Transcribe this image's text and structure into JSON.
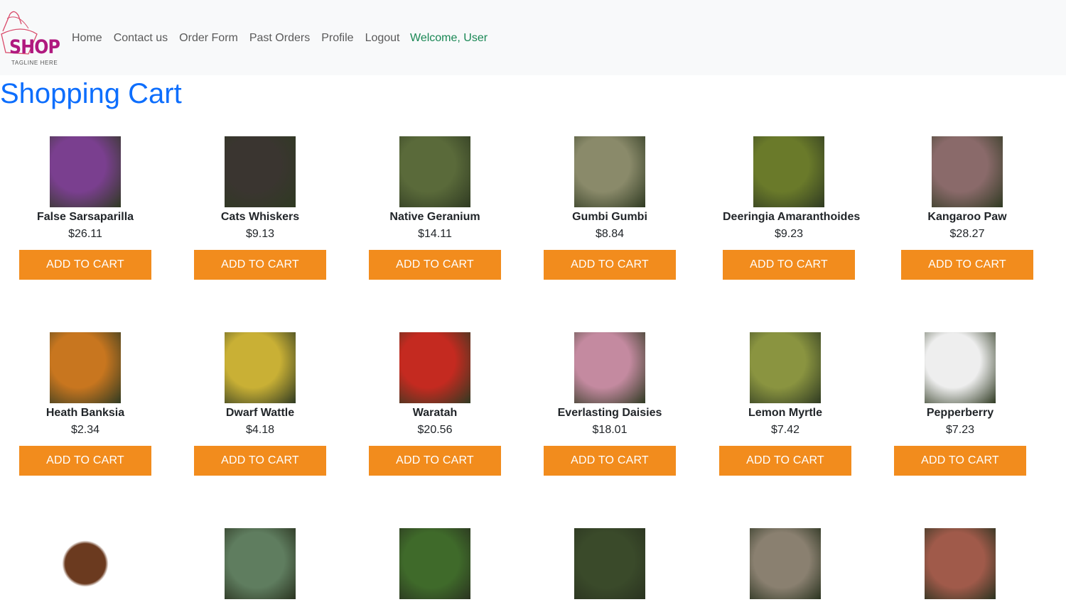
{
  "brand": {
    "logo_text": "SHOP",
    "tagline": "TAGLINE HERE"
  },
  "nav": {
    "links": [
      "Home",
      "Contact us",
      "Order Form",
      "Past Orders",
      "Profile",
      "Logout"
    ],
    "welcome": "Welcome, User"
  },
  "page": {
    "title": "Shopping Cart"
  },
  "button_label": "ADD TO CART",
  "products": [
    {
      "name": "False Sarsaparilla",
      "price": "$26.11",
      "icon": "purple-pea-flower-photo",
      "color": "#7a3f8f"
    },
    {
      "name": "Cats Whiskers",
      "price": "$9.13",
      "icon": "white-flower-spikes-photo",
      "color": "#3a3530"
    },
    {
      "name": "Native Geranium",
      "price": "$14.11",
      "icon": "pink-geranium-photo",
      "color": "#5a6a3a"
    },
    {
      "name": "Gumbi Gumbi",
      "price": "$8.84",
      "icon": "orange-fruit-photo",
      "color": "#8a8a6a"
    },
    {
      "name": "Deeringia Amaranthoides",
      "price": "$9.23",
      "icon": "red-berry-vine-photo",
      "color": "#6a7a2a"
    },
    {
      "name": "Kangaroo Paw",
      "price": "$28.27",
      "icon": "kangaroo-paw-photo",
      "color": "#8a6a6a"
    },
    {
      "name": "Heath Banksia",
      "price": "$2.34",
      "icon": "banksia-photo",
      "color": "#c8761f"
    },
    {
      "name": "Dwarf Wattle",
      "price": "$4.18",
      "icon": "yellow-wattle-photo",
      "color": "#c9b035"
    },
    {
      "name": "Waratah",
      "price": "$20.56",
      "icon": "red-waratah-photo",
      "color": "#c42a20"
    },
    {
      "name": "Everlasting Daisies",
      "price": "$18.01",
      "icon": "pink-daisies-photo",
      "color": "#c48aa0"
    },
    {
      "name": "Lemon Myrtle",
      "price": "$7.42",
      "icon": "dried-leaves-photo",
      "color": "#8a9440"
    },
    {
      "name": "Pepperberry",
      "price": "$7.23",
      "icon": "pepper-bowl-photo",
      "color": "#eeeeee"
    }
  ],
  "third_row": [
    {
      "icon": "ground-spice-photo",
      "color": "#6b3a1f"
    },
    {
      "icon": "green-fruit-photo",
      "color": "#5f7d5f"
    },
    {
      "icon": "green-herb-photo",
      "color": "#3f6a2a"
    },
    {
      "icon": "dark-berries-photo",
      "color": "#3a4a2a"
    },
    {
      "icon": "seed-pod-photo",
      "color": "#8a8070"
    },
    {
      "icon": "red-berries-photo",
      "color": "#a05a4a"
    }
  ]
}
